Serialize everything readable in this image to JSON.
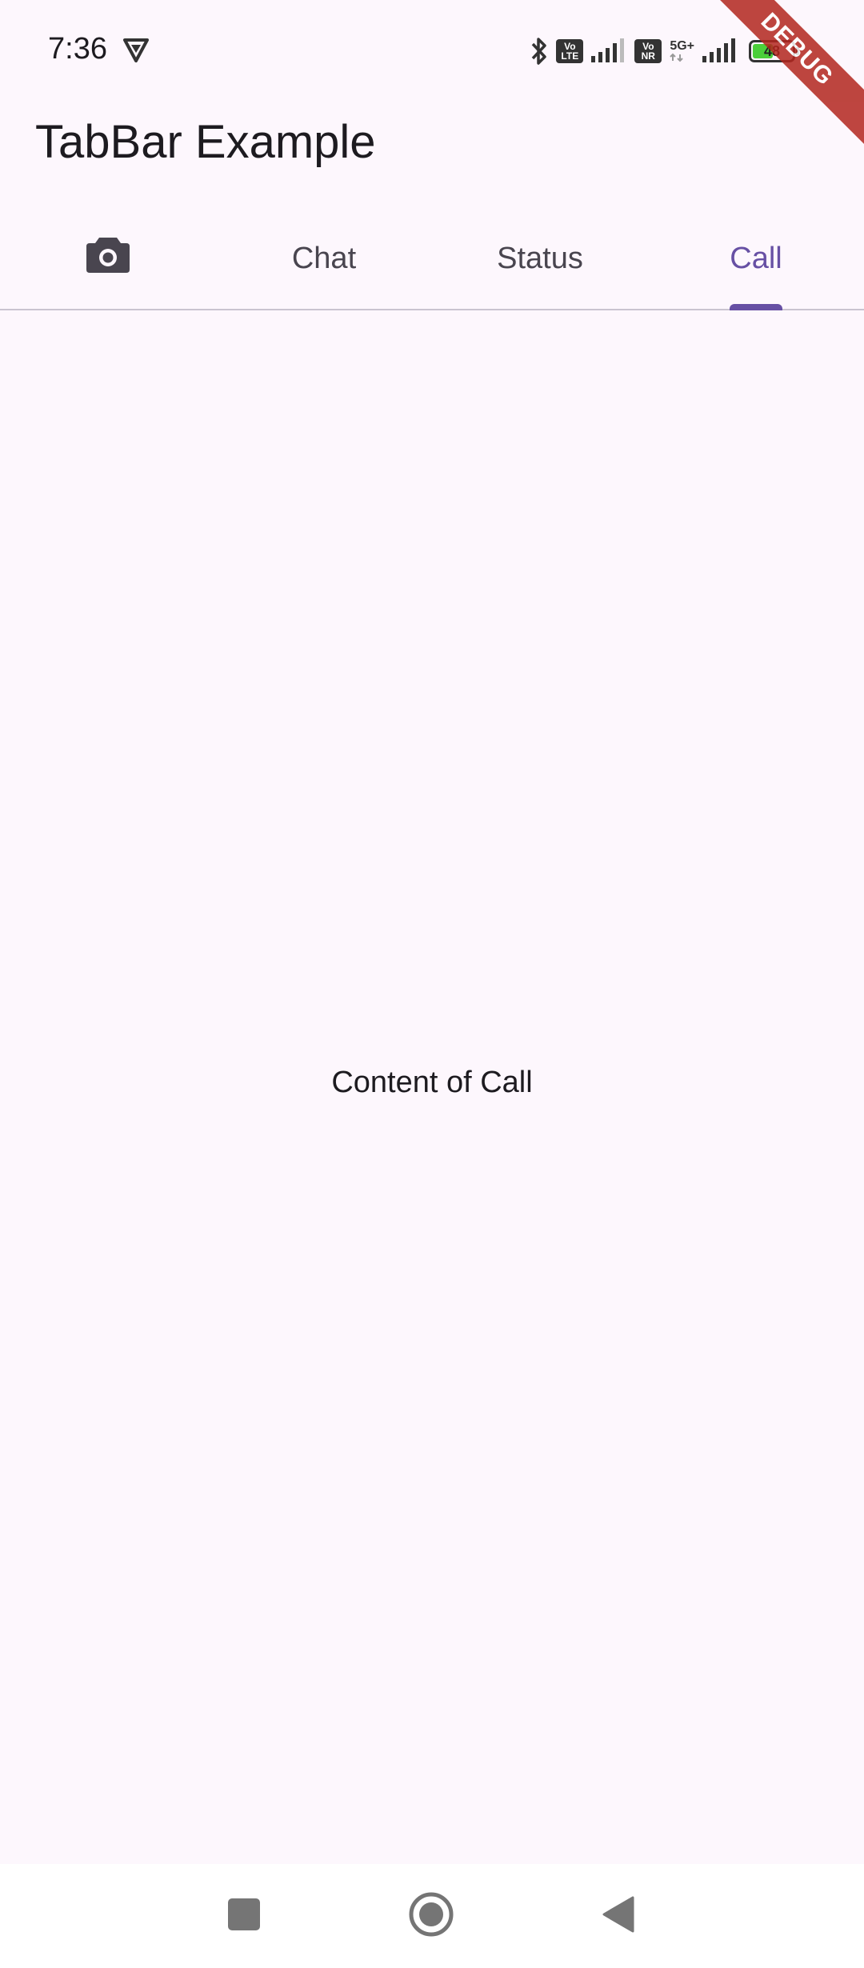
{
  "status_bar": {
    "time": "7:36",
    "battery_level": "48",
    "network_label": "5G+",
    "volte_label": "Vo\nLTE",
    "vonr_label": "Vo\nNR"
  },
  "debug_banner": "DEBUG",
  "app_bar": {
    "title": "TabBar Example"
  },
  "tabs": [
    {
      "label": "",
      "icon": "camera-icon",
      "active": false
    },
    {
      "label": "Chat",
      "active": false
    },
    {
      "label": "Status",
      "active": false
    },
    {
      "label": "Call",
      "active": true
    }
  ],
  "content": {
    "text": "Content of Call"
  },
  "navigation": {
    "buttons": [
      "recents-square-icon",
      "home-circle-icon",
      "back-triangle-icon"
    ]
  },
  "colors": {
    "background": "#fdf7fd",
    "accent": "#6750a4",
    "debug": "#b3261e",
    "battery": "#4bcf3a"
  }
}
